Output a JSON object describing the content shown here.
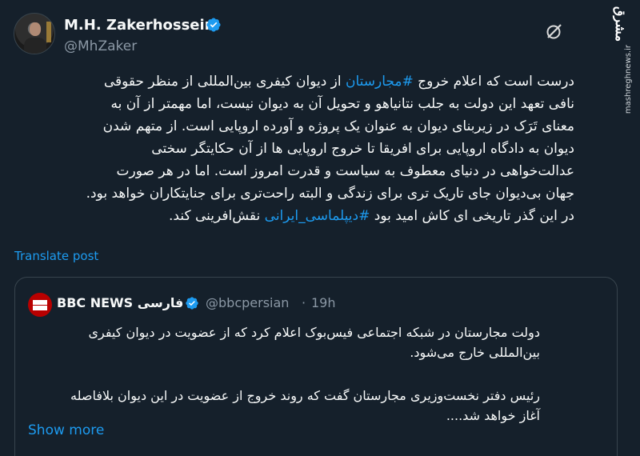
{
  "author": {
    "name": "M.H. Zakerhossein",
    "handle": "@MhZaker"
  },
  "watermark": {
    "brand": "مشرق",
    "site": "mashreghnews.ir"
  },
  "tweet": {
    "lines": [
      {
        "before": "درست است که اعلام خروج ",
        "hashtag": "#مجارستان",
        "after": " از دیوان کیفری بین‌المللی از منظر حقوقی"
      },
      {
        "text": "نافی تعهد این دولت به جلب نتانیاهو و تحویل آن به دیوان نیست، اما مهمتر از آن به"
      },
      {
        "text": "معنای تَرَک در زیربنای دیوان به عنوان یک پروژه و آورده اروپایی است. از متهم شدن"
      },
      {
        "text": "دیوان به دادگاه اروپایی برای افریقا تا خروج اروپایی ها از آن حکایتگر سختی"
      },
      {
        "text": "عدالت‌خواهی در دنیای معطوف به سیاست و قدرت امروز است. اما در هر صورت"
      },
      {
        "text": "جهان بی‌دیوان جای تاریک تری برای زندگی و البته راحت‌تری برای جنایتکاران خواهد بود."
      },
      {
        "before": "در این گذر تاریخی ای کاش امید بود ",
        "hashtag": "#دیپلماسی_ایرانی",
        "after": " نقش‌افرینی کند."
      }
    ],
    "translate_label": "Translate post"
  },
  "quote": {
    "name": "BBC NEWS فارسی",
    "handle": "@bbcpersian",
    "separator": "·",
    "time": "19h",
    "para1": [
      "دولت مجارستان در شبکه اجتماعی فیس‌بوک اعلام کرد که از عضویت در دیوان کیفری",
      "بین‌المللی خارج می‌شود."
    ],
    "para2": [
      "رئیس دفتر نخست‌وزیری مجارستان گفت که روند خروج از عضویت در این دیوان بلافاصله",
      "آغاز خواهد شد...."
    ],
    "show_more": "Show more"
  },
  "colors": {
    "background": "#15202b",
    "accent": "#1d9bf0",
    "secondary_text": "#8b98a5",
    "border": "#38444d",
    "bbc_red": "#b80000"
  },
  "icons": [
    "verified-badge-icon",
    "grok-icon",
    "bbc-logo-icon"
  ]
}
